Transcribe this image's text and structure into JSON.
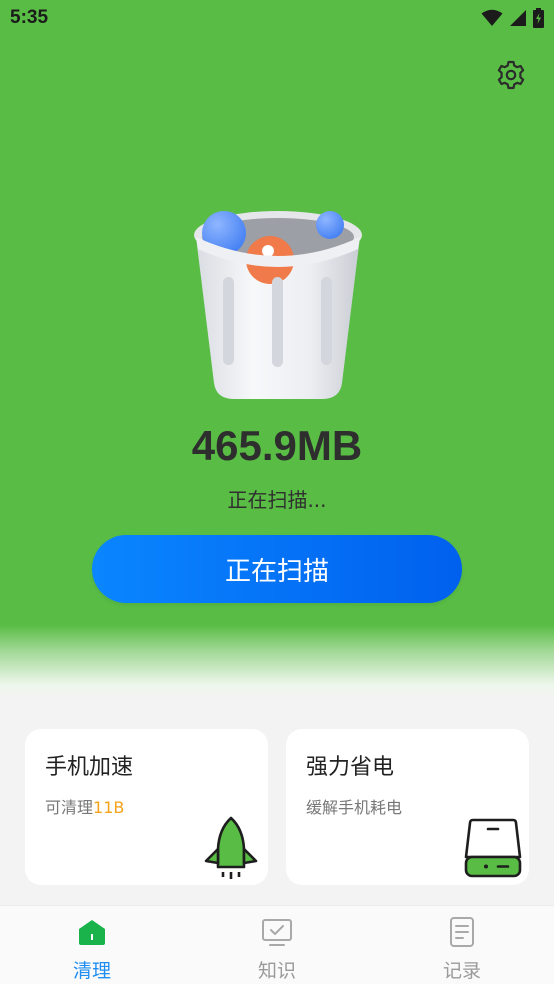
{
  "status_bar": {
    "time": "5:35"
  },
  "scan": {
    "size": "465.9MB",
    "status": "正在扫描...",
    "button_label": "正在扫描"
  },
  "cards": [
    {
      "title": "手机加速",
      "subtitle_prefix": "可清理",
      "subtitle_highlight": "11B",
      "icon": "rocket-icon"
    },
    {
      "title": "强力省电",
      "subtitle_prefix": "缓解手机耗电",
      "subtitle_highlight": "",
      "icon": "battery-icon"
    }
  ],
  "tabs": [
    {
      "label": "清理",
      "icon": "home-icon",
      "active": true
    },
    {
      "label": "知识",
      "icon": "monitor-check-icon",
      "active": false
    },
    {
      "label": "记录",
      "icon": "document-icon",
      "active": false
    }
  ],
  "colors": {
    "hero_green": "#59bd45",
    "button_blue": "#0a86ff",
    "highlight_orange": "#f5a31a",
    "active_tab_blue": "#1f8ef0"
  }
}
